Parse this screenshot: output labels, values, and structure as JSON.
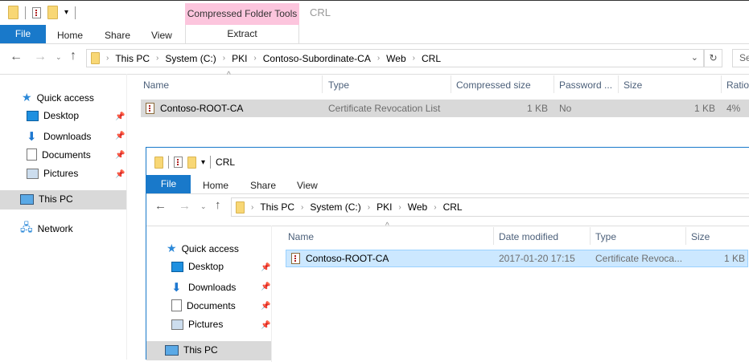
{
  "back_window": {
    "context_tab": "Compressed Folder Tools",
    "title": "CRL",
    "ribbon_tabs": [
      "File",
      "Home",
      "Share",
      "View"
    ],
    "context_subtab": "Extract",
    "breadcrumb": [
      "This PC",
      "System (C:)",
      "PKI",
      "Contoso-Subordinate-CA",
      "Web",
      "CRL"
    ],
    "search_placeholder": "Se",
    "columns": [
      "Name",
      "Type",
      "Compressed size",
      "Password ...",
      "Size",
      "Ratio"
    ],
    "rows": [
      {
        "name": "Contoso-ROOT-CA",
        "type": "Certificate Revocation List",
        "compressed": "1 KB",
        "password": "No",
        "size": "1 KB",
        "ratio": "4%"
      }
    ],
    "nav": {
      "quick_access": "Quick access",
      "items": [
        "Desktop",
        "Downloads",
        "Documents",
        "Pictures"
      ],
      "this_pc": "This PC",
      "network": "Network"
    }
  },
  "front_window": {
    "title": "CRL",
    "ribbon_tabs": [
      "File",
      "Home",
      "Share",
      "View"
    ],
    "breadcrumb": [
      "This PC",
      "System (C:)",
      "PKI",
      "Web",
      "CRL"
    ],
    "columns": [
      "Name",
      "Date modified",
      "Type",
      "Size"
    ],
    "rows": [
      {
        "name": "Contoso-ROOT-CA",
        "date": "2017-01-20 17:15",
        "type": "Certificate Revoca...",
        "size": "1 KB"
      }
    ],
    "nav": {
      "quick_access": "Quick access",
      "items": [
        "Desktop",
        "Downloads",
        "Documents",
        "Pictures"
      ],
      "this_pc": "This PC"
    }
  },
  "colors": {
    "file_tab": "#1979ca",
    "context_tab": "#fcc5dd",
    "selected_gray": "#d9d9d9",
    "selected_blue": "#cce8ff"
  }
}
